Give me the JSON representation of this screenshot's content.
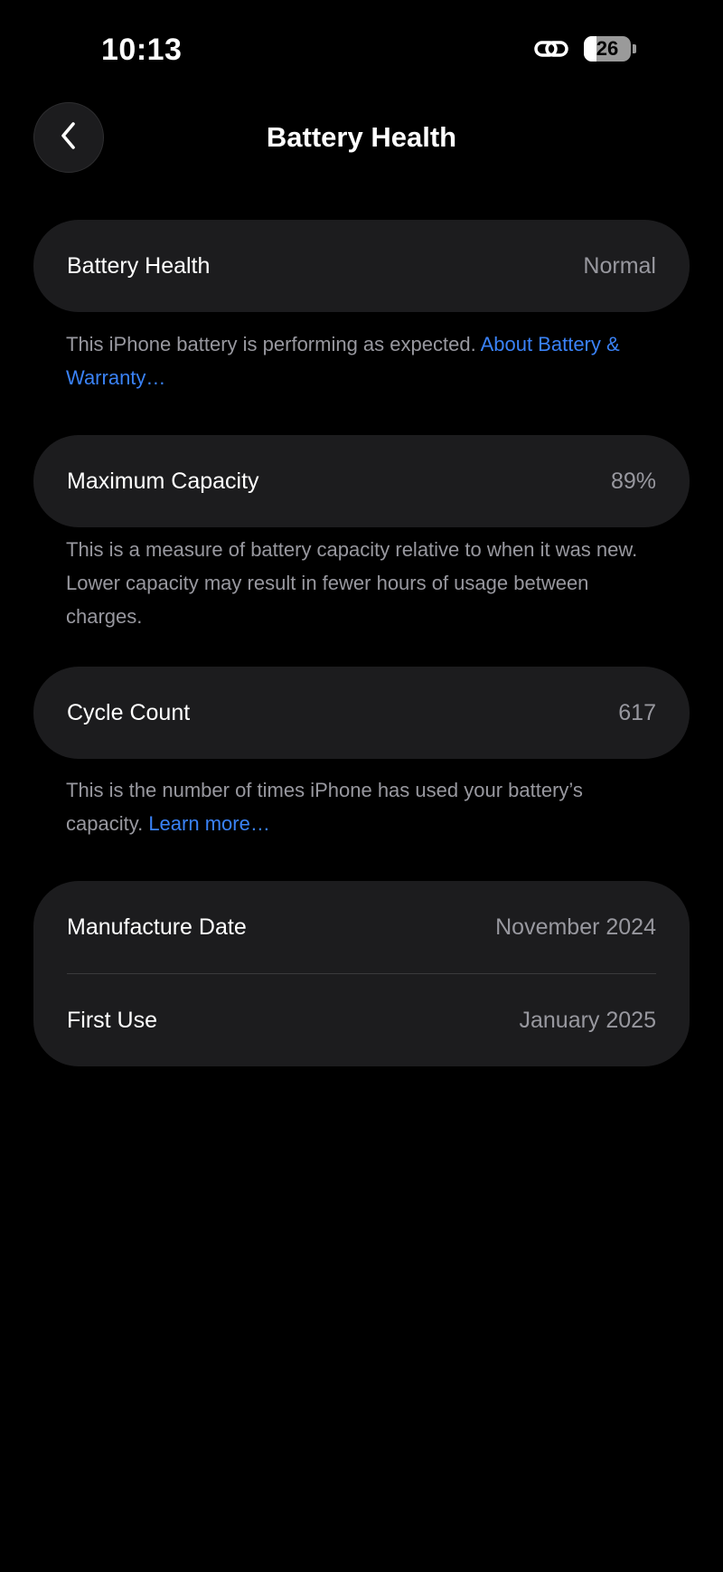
{
  "status_bar": {
    "time": "10:13",
    "battery_level": 26,
    "battery_label": "26"
  },
  "header": {
    "title": "Battery Health"
  },
  "sections": {
    "health": {
      "label": "Battery Health",
      "value": "Normal",
      "note_text": "This iPhone battery is performing as expected. ",
      "note_link": "About Battery & Warranty…"
    },
    "capacity": {
      "label": "Maximum Capacity",
      "value": "89%",
      "note_text": "This is a measure of battery capacity relative to when it was new. Lower capacity may result in fewer hours of usage between charges."
    },
    "cycles": {
      "label": "Cycle Count",
      "value": "617",
      "note_text": "This is the number of times iPhone has used your battery’s capacity. ",
      "note_link": "Learn more…"
    },
    "dates": {
      "manufacture_label": "Manufacture Date",
      "manufacture_value": "November 2024",
      "first_use_label": "First Use",
      "first_use_value": "January 2025"
    }
  },
  "colors": {
    "background": "#000000",
    "card": "#1c1c1e",
    "secondary_text": "#98989f",
    "link": "#3a82f7"
  }
}
